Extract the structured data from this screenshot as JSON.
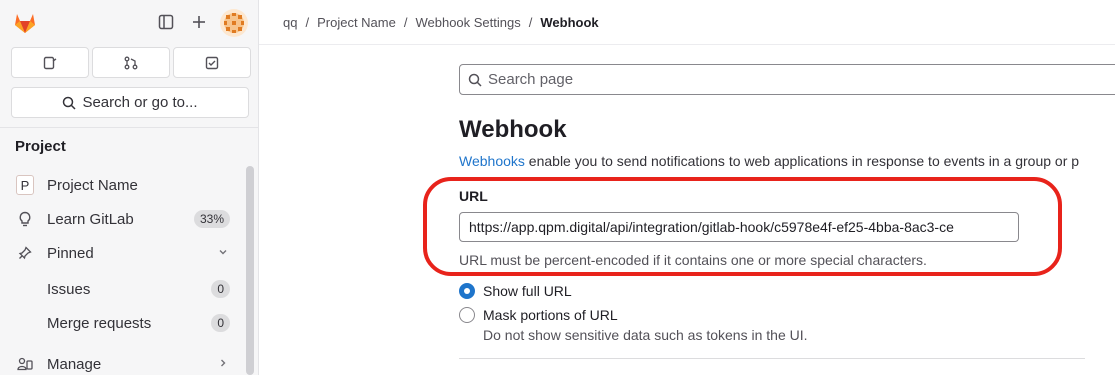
{
  "sidebar": {
    "search_label": "Search or go to...",
    "section_title": "Project",
    "items": [
      {
        "label": "Project Name",
        "letter": "P"
      },
      {
        "label": "Learn GitLab",
        "badge": "33%"
      },
      {
        "label": "Pinned"
      },
      {
        "label": "Issues",
        "badge": "0"
      },
      {
        "label": "Merge requests",
        "badge": "0"
      },
      {
        "label": "Manage"
      }
    ]
  },
  "breadcrumb": {
    "items": [
      "qq",
      "Project Name",
      "Webhook Settings"
    ],
    "separator": "/",
    "current": "Webhook"
  },
  "main": {
    "search_placeholder": "Search page",
    "title": "Webhook",
    "desc_link": "Webhooks",
    "desc_text": " enable you to send notifications to web applications in response to events in a group or p",
    "url_label": "URL",
    "url_value": "https://app.qpm.digital/api/integration/gitlab-hook/c5978e4f-ef25-4bba-8ac3-ce",
    "url_hint": "URL must be percent-encoded if it contains one or more special characters.",
    "radio_show": "Show full URL",
    "radio_mask": "Mask portions of URL",
    "radio_mask_help": "Do not show sensitive data such as tokens in the UI."
  },
  "colors": {
    "accent": "#1f75cb",
    "highlight": "#e8231b",
    "gitlab_orange": "#fc6d26"
  }
}
